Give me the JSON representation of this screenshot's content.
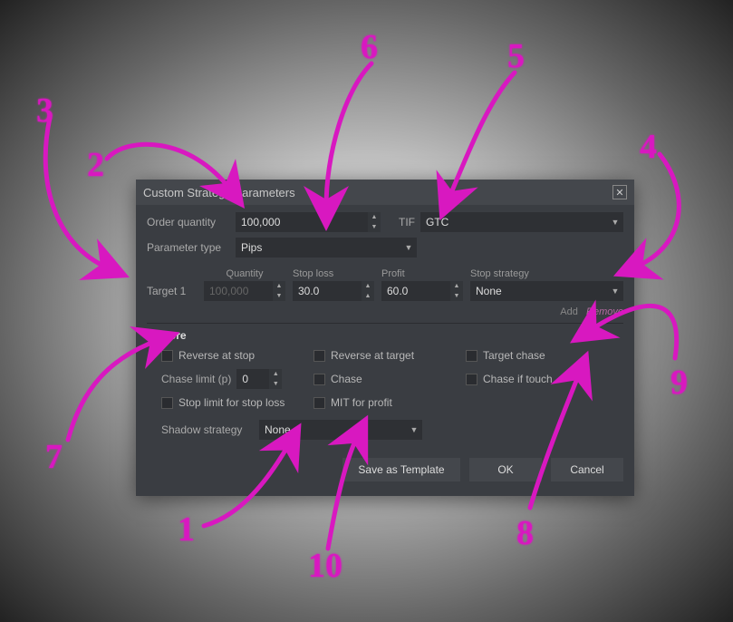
{
  "dialog": {
    "title": "Custom Strategy Parameters",
    "order_quantity_label": "Order quantity",
    "order_quantity_value": "100,000",
    "tif_label": "TIF",
    "tif_value": "GTC",
    "parameter_type_label": "Parameter type",
    "parameter_type_value": "Pips",
    "columns": {
      "quantity": "Quantity",
      "stop_loss": "Stop loss",
      "profit": "Profit",
      "stop_strategy": "Stop strategy"
    },
    "targets": [
      {
        "label": "Target 1",
        "quantity": "100,000",
        "stop_loss": "30.0",
        "profit": "60.0",
        "stop_strategy": "None"
      }
    ],
    "add_label": "Add",
    "remove_label": "Remove",
    "more_label": "More",
    "checkboxes": {
      "reverse_at_stop": "Reverse at stop",
      "reverse_at_target": "Reverse at target",
      "target_chase": "Target chase",
      "chase": "Chase",
      "chase_if_touch": "Chase if touch",
      "stop_limit_for_stop_loss": "Stop limit for stop loss",
      "mit_for_profit": "MIT for profit"
    },
    "chase_limit_label": "Chase limit (p)",
    "chase_limit_value": "0",
    "shadow_strategy_label": "Shadow strategy",
    "shadow_strategy_value": "None",
    "buttons": {
      "save_as_template": "Save as Template",
      "ok": "OK",
      "cancel": "Cancel"
    }
  },
  "annotations": {
    "n1": "1",
    "n2": "2",
    "n3": "3",
    "n4": "4",
    "n5": "5",
    "n6": "6",
    "n7": "7",
    "n8": "8",
    "n9": "9",
    "n10": "10"
  },
  "colors": {
    "accent": "#d818c0",
    "panel": "#3a3d42",
    "panel_light": "#44474c",
    "input_bg": "#2e3034"
  }
}
